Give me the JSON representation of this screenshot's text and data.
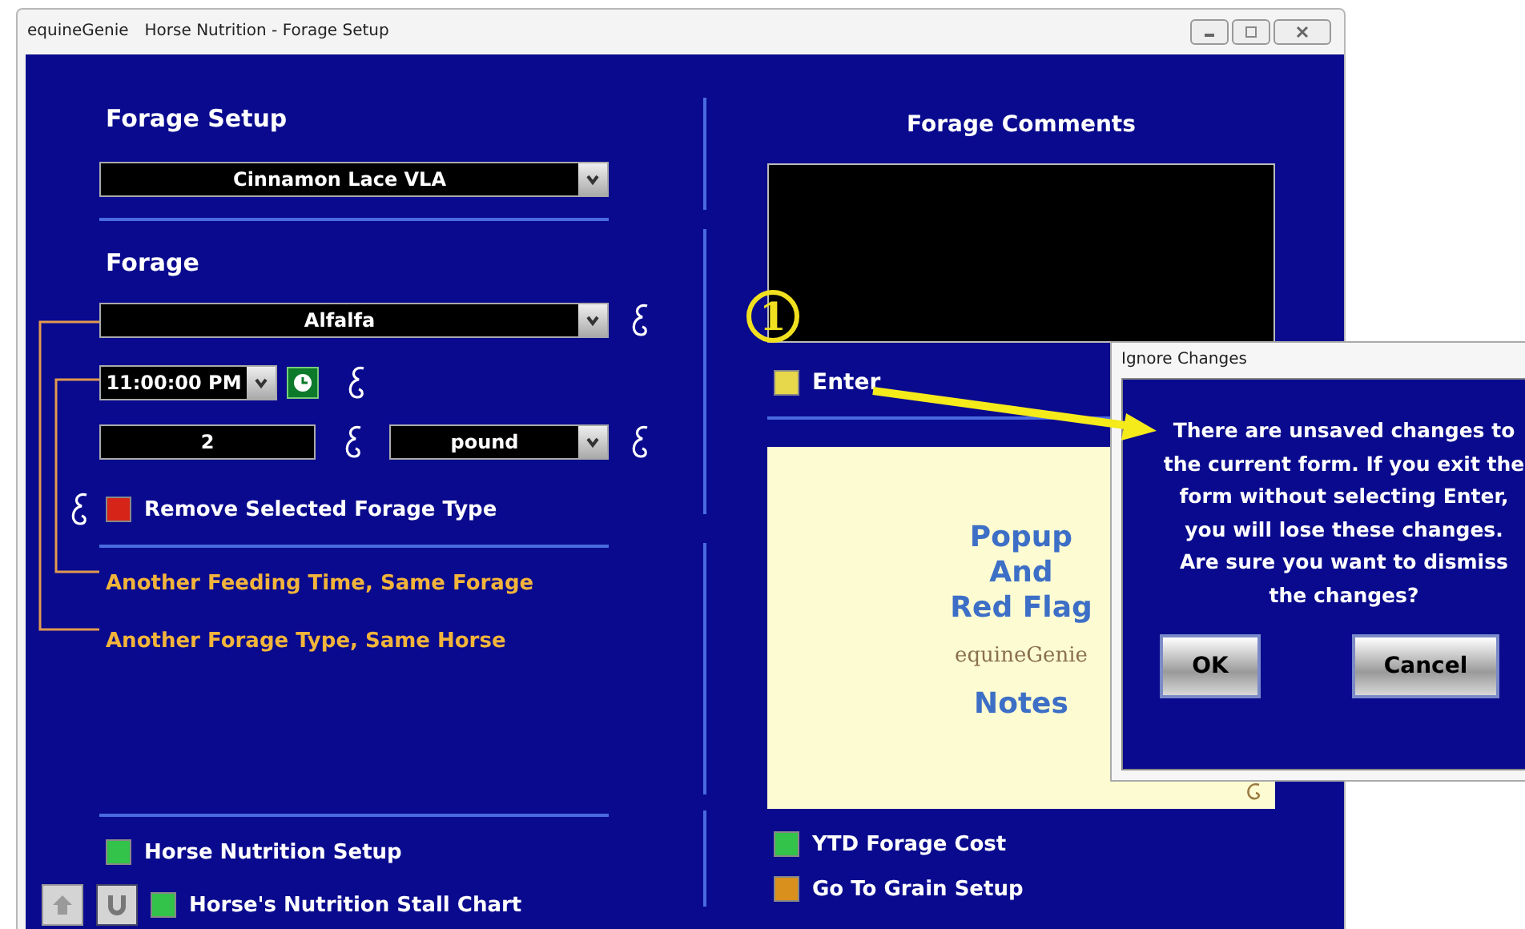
{
  "window": {
    "app_name": "equineGenie",
    "title": "Horse Nutrition - Forage Setup"
  },
  "forage_setup": {
    "heading": "Forage Setup",
    "horse": "Cinnamon Lace VLA"
  },
  "forage": {
    "heading": "Forage",
    "type": "Alfalfa",
    "time": "11:00:00 PM",
    "quantity": "2",
    "unit": "pound",
    "remove_button": "Remove Selected Forage Type"
  },
  "links": [
    "Another Feeding Time, Same Forage",
    "Another Forage Type, Same Horse"
  ],
  "nav_left": [
    {
      "label": "Horse Nutrition Setup",
      "color": "#33c24a"
    },
    {
      "label": "Horse's Nutrition Stall Chart",
      "color": "#33c24a"
    }
  ],
  "comments": {
    "heading": "Forage Comments",
    "enter_button": "Enter"
  },
  "notes_panel": {
    "lines": [
      "Popup",
      "And",
      "Red Flag"
    ],
    "logo": "equineGenie",
    "footer": "Notes"
  },
  "nav_right": [
    {
      "label": "YTD Forage Cost",
      "color": "#33c24a"
    },
    {
      "label": "Go To Grain Setup",
      "color": "#d9901c"
    }
  ],
  "annotation": {
    "marker": "1"
  },
  "dialog": {
    "title": "Ignore Changes",
    "message": [
      "There are unsaved changes to the current form. If you exit the form without selecting Enter, you will lose these changes.",
      "Are sure you want to dismiss the changes?"
    ],
    "buttons": [
      "OK",
      "Cancel"
    ]
  }
}
